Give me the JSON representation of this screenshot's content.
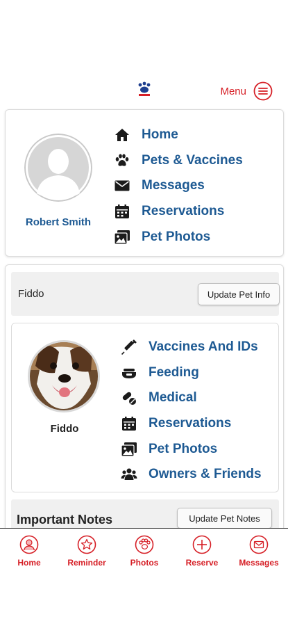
{
  "header": {
    "menu_label": "Menu"
  },
  "owner": {
    "name": "Robert Smith",
    "nav": [
      {
        "label": "Home",
        "icon": "house-icon"
      },
      {
        "label": "Pets & Vaccines",
        "icon": "paw-icon"
      },
      {
        "label": "Messages",
        "icon": "envelope-icon"
      },
      {
        "label": "Reservations",
        "icon": "calendar-icon"
      },
      {
        "label": "Pet Photos",
        "icon": "images-icon"
      }
    ]
  },
  "pet": {
    "bar_name": "Fiddo",
    "update_info_label": "Update Pet Info",
    "name": "Fiddo",
    "nav": [
      {
        "label": "Vaccines And IDs",
        "icon": "syringe-icon"
      },
      {
        "label": "Feeding",
        "icon": "bowl-icon"
      },
      {
        "label": "Medical",
        "icon": "pills-icon"
      },
      {
        "label": "Reservations",
        "icon": "calendar-icon"
      },
      {
        "label": "Pet Photos",
        "icon": "images-icon"
      },
      {
        "label": "Owners & Friends",
        "icon": "users-icon"
      }
    ],
    "notes_title": "Important Notes",
    "update_notes_label": "Update Pet Notes"
  },
  "bottom_nav": [
    {
      "label": "Home",
      "icon": "home-circle-icon"
    },
    {
      "label": "Reminder",
      "icon": "star-icon"
    },
    {
      "label": "Photos",
      "icon": "paw-circle-icon"
    },
    {
      "label": "Reserve",
      "icon": "plus-circle-icon"
    },
    {
      "label": "Messages",
      "icon": "mail-circle-icon"
    }
  ],
  "colors": {
    "accent_red": "#d61f26",
    "link_blue": "#1e5a93",
    "icon_dark": "#1b1b1b"
  }
}
